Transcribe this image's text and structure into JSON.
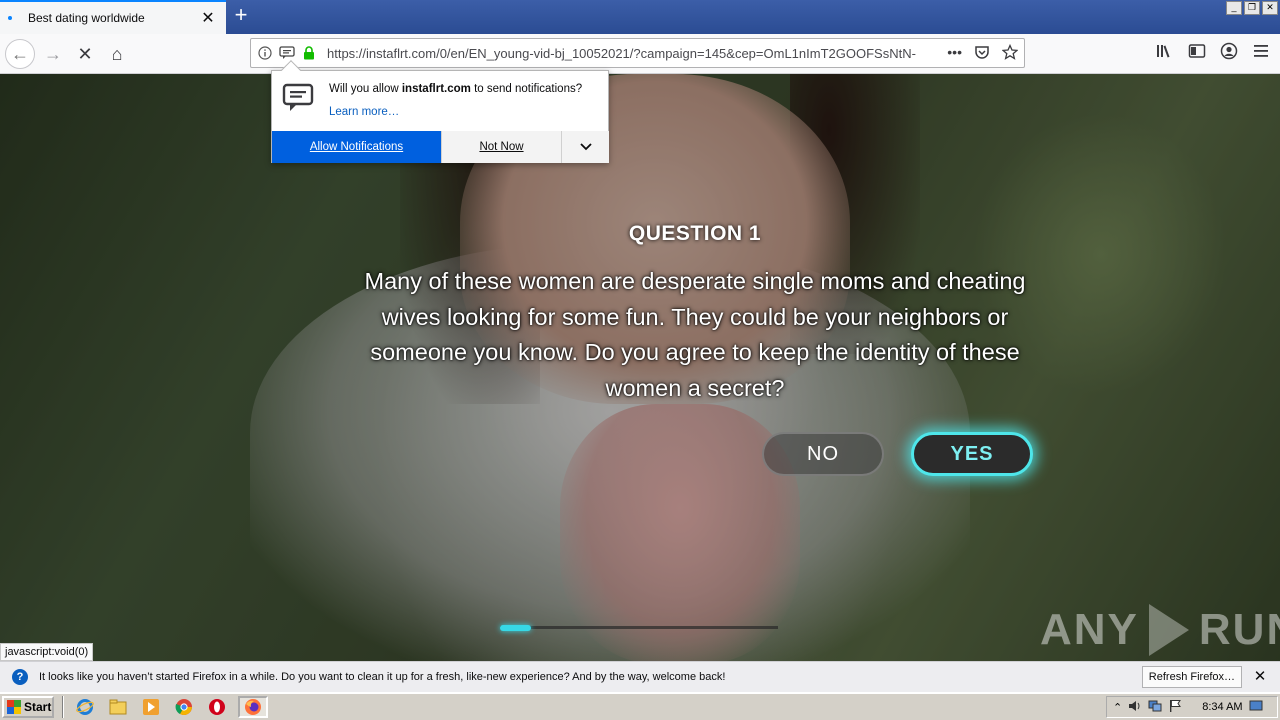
{
  "tab": {
    "title": "Best dating worldwide",
    "close": "✕",
    "new_tab": "+"
  },
  "window": {
    "minimize": "_",
    "restore": "❐",
    "close": "✕"
  },
  "navbar": {
    "back": "←",
    "forward": "→",
    "stop": "✕",
    "home": "⌂",
    "url": "https://instaflrt.com/0/en/EN_young-vid-bj_10052021/?campaign=145&cep=OmL1nImT2GOOFSsNtN-",
    "page_actions": "•••",
    "pocket": "♡",
    "bookmark": "☆"
  },
  "doorhanger": {
    "message_prefix": "Will you allow ",
    "site": "instaflrt.com",
    "message_suffix": " to send notifications?",
    "learn_more": "Learn more…",
    "allow_label": "Allow Notifications",
    "not_now_label": "Not Now",
    "more_label": "⌄"
  },
  "page": {
    "question_title": "QUESTION 1",
    "question_text": "Many of these women are desperate single moms and cheating wives looking for some fun. They could be your neighbors or someone you know. Do you agree to keep the identity of these women a secret?",
    "no_label": "NO",
    "yes_label": "YES",
    "progress_fraction": 0.11,
    "accent_color": "#4ee6ea",
    "watermark": {
      "left": "ANY",
      "right": "RUN"
    }
  },
  "status_link": "javascript:void(0)",
  "notification_bar": {
    "text": "It looks like you haven’t started Firefox in a while. Do you want to clean it up for a fresh, like-new experience? And by the way, welcome back!",
    "button": "Refresh Firefox…",
    "close": "✕"
  },
  "taskbar": {
    "start": "Start",
    "apps": [
      "ie-icon",
      "explorer-icon",
      "media-player-icon",
      "chrome-icon",
      "opera-icon",
      "firefox-icon"
    ],
    "clock": "8:34 AM"
  }
}
